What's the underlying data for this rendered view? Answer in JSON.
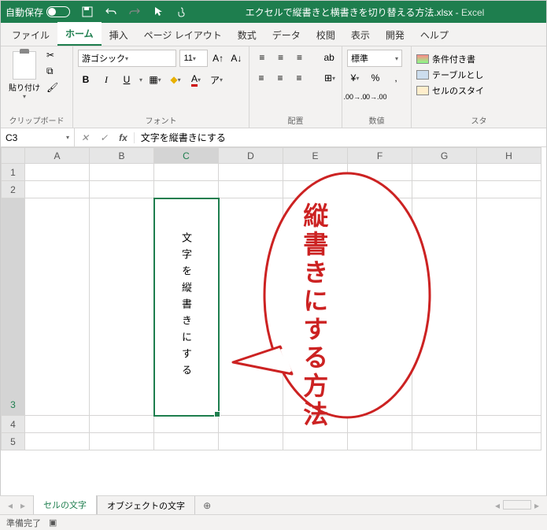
{
  "title_bar": {
    "autosave_label": "自動保存",
    "autosave_state": "オフ",
    "filename": "エクセルで縦書きと横書きを切り替える方法.xlsx",
    "app": "Excel"
  },
  "tabs": {
    "file": "ファイル",
    "home": "ホーム",
    "insert": "挿入",
    "page_layout": "ページ レイアウト",
    "formulas": "数式",
    "data": "データ",
    "review": "校閲",
    "view": "表示",
    "developer": "開発",
    "help": "ヘルプ"
  },
  "ribbon": {
    "clipboard": {
      "paste": "貼り付け",
      "label": "クリップボード"
    },
    "font": {
      "name": "游ゴシック",
      "size": "11",
      "label": "フォント"
    },
    "align": {
      "wrap": "ab",
      "label": "配置"
    },
    "number": {
      "format": "標準",
      "label": "数値"
    },
    "styles": {
      "cond": "条件付き書",
      "table": "テーブルとし",
      "cell": "セルのスタイ",
      "label": "スタ"
    }
  },
  "formula_bar": {
    "cell_ref": "C3",
    "value": "文字を縦書きにする"
  },
  "grid": {
    "cols": [
      "A",
      "B",
      "C",
      "D",
      "E",
      "F",
      "G",
      "H"
    ],
    "rows": [
      "1",
      "2",
      "3",
      "4",
      "5"
    ],
    "c3_text": "文字を縦書きにする"
  },
  "callout": {
    "text": "縦書きにする方法"
  },
  "sheets": {
    "tab1": "セルの文字",
    "tab2": "オブジェクトの文字"
  },
  "status": {
    "ready": "準備完了"
  }
}
